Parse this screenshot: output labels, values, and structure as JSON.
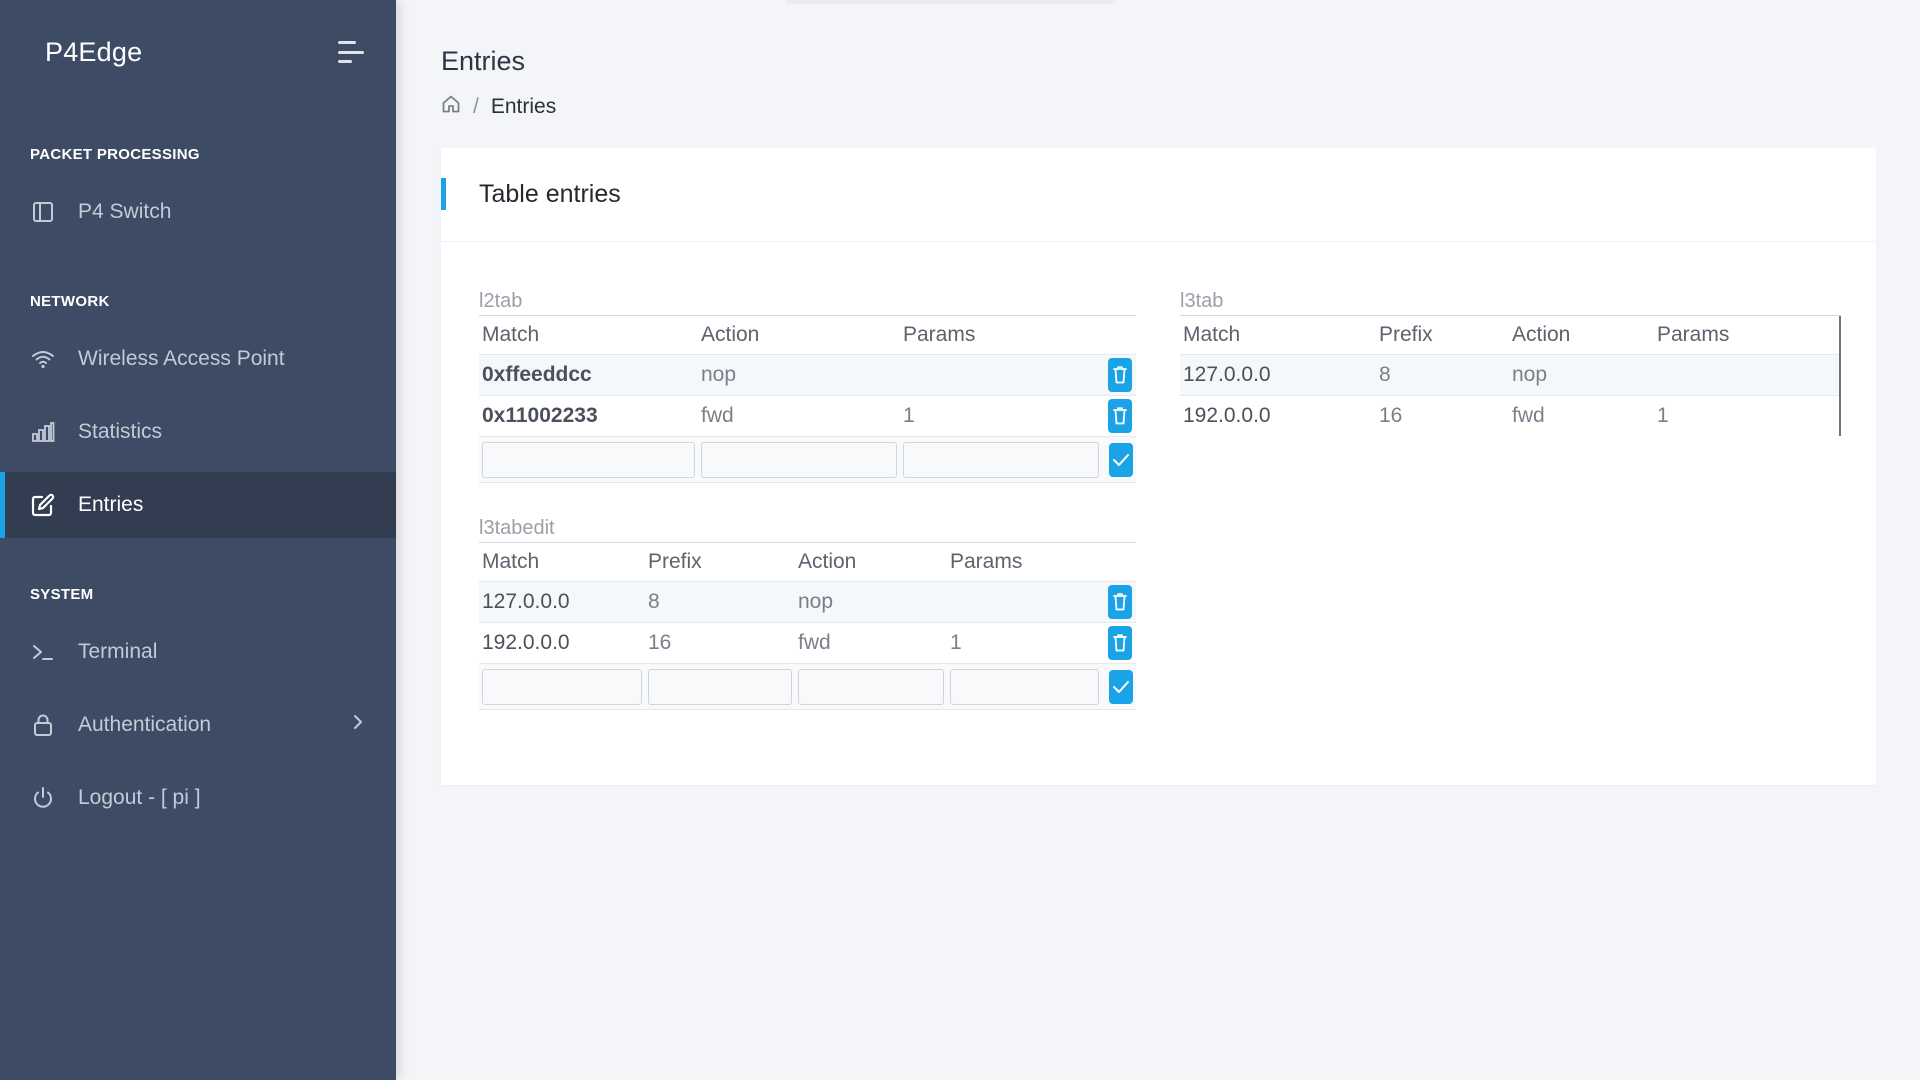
{
  "sidebar": {
    "brand": "P4Edge",
    "sections": {
      "packet_processing": "PACKET PROCESSING",
      "network": "NETWORK",
      "system": "SYSTEM"
    },
    "items": {
      "p4switch": "P4 Switch",
      "wap": "Wireless Access Point",
      "statistics": "Statistics",
      "entries": "Entries",
      "terminal": "Terminal",
      "authentication": "Authentication",
      "logout": "Logout - [ pi ]"
    },
    "active": "entries"
  },
  "header": {
    "title": "Entries",
    "breadcrumb_sep": "/",
    "breadcrumb_current": "Entries"
  },
  "card": {
    "title": "Table entries"
  },
  "tables": {
    "l2tab": {
      "caption": "l2tab",
      "columns": [
        "Match",
        "Action",
        "Params"
      ],
      "rows": [
        {
          "match": "0xffeeddcc",
          "action": "nop",
          "params": ""
        },
        {
          "match": "0x11002233",
          "action": "fwd",
          "params": "1"
        }
      ]
    },
    "l3tabedit": {
      "caption": "l3tabedit",
      "columns": [
        "Match",
        "Prefix",
        "Action",
        "Params"
      ],
      "rows": [
        {
          "match": "127.0.0.0",
          "prefix": "8",
          "action": "nop",
          "params": ""
        },
        {
          "match": "192.0.0.0",
          "prefix": "16",
          "action": "fwd",
          "params": "1"
        }
      ]
    },
    "l3tab": {
      "caption": "l3tab",
      "columns": [
        "Match",
        "Prefix",
        "Action",
        "Params"
      ],
      "rows": [
        {
          "match": "127.0.0.0",
          "prefix": "8",
          "action": "nop",
          "params": ""
        },
        {
          "match": "192.0.0.0",
          "prefix": "16",
          "action": "fwd",
          "params": "1"
        }
      ]
    }
  },
  "colors": {
    "sidebar_bg": "#3e4b64",
    "sidebar_active_bg": "#323d52",
    "accent": "#1aa3e6",
    "page_bg": "#f4f5f8"
  },
  "icons": {
    "menu_toggle": "menu-toggle-icon",
    "p4switch": "sidebar-panel-icon",
    "wap": "wifi-icon",
    "statistics": "bar-chart-icon",
    "entries": "edit-icon",
    "terminal": "terminal-icon",
    "authentication": "lock-icon",
    "logout": "power-icon",
    "home": "home-icon",
    "delete": "trash-icon",
    "confirm": "check-icon"
  }
}
